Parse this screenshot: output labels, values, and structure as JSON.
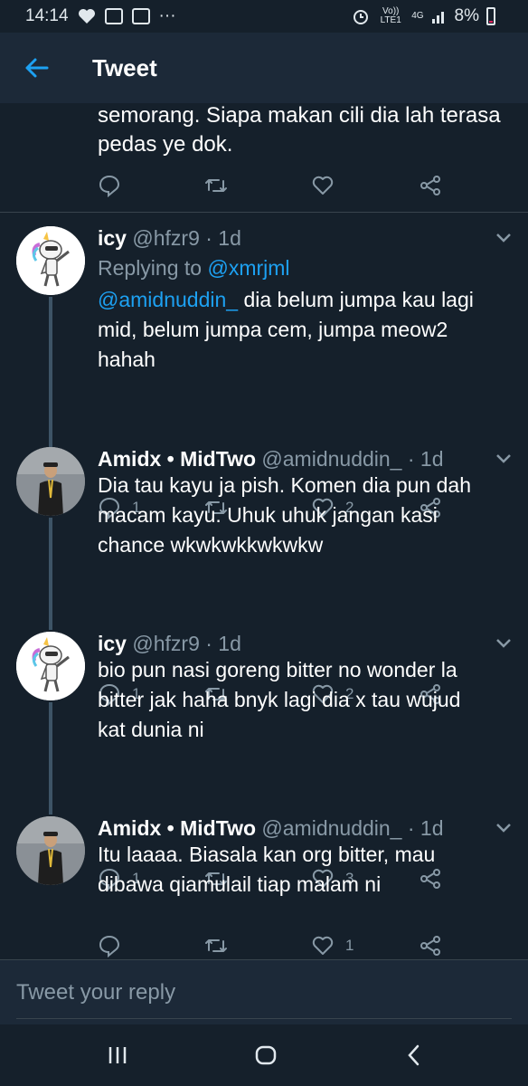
{
  "status_bar": {
    "time": "14:14",
    "signal_text": "Vo)) LTE1",
    "network": "4G",
    "battery": "8%"
  },
  "header": {
    "title": "Tweet"
  },
  "previous_tweet": {
    "text_line1": "semorang. Siapa makan cili dia lah terasa",
    "text_line2": "pedas ye dok."
  },
  "tweets": [
    {
      "name": "icy",
      "handle": "@hfzr9",
      "time": "· 1d",
      "replying_label": "Replying to",
      "replying_to": "@xmrjml",
      "mention": "@amidnuddin_",
      "text_line1": " dia belum jumpa kau lagi",
      "text_line2": "mid, belum jumpa cem, jumpa meow2",
      "text_line3": "hahah",
      "replies": "1",
      "likes": "2"
    },
    {
      "name": "Amidx • MidTwo",
      "handle": "@amidnuddin_",
      "time": "· 1d",
      "text_line1": "Dia tau kayu ja pish. Komen dia pun dah",
      "text_line2": "macam kayu. Uhuk uhuk jangan kasi",
      "text_line3": "chance wkwkwkkwkwkw",
      "replies": "1",
      "likes": "2"
    },
    {
      "name": "icy",
      "handle": "@hfzr9",
      "time": "· 1d",
      "text_line1": "bio pun nasi goreng bitter no wonder la",
      "text_line2": "bitter jak haha bnyk lagi dia x tau wujud",
      "text_line3": "kat dunia ni",
      "replies": "1",
      "likes": "3"
    },
    {
      "name": "Amidx • MidTwo",
      "handle": "@amidnuddin_",
      "time": "· 1d",
      "text_line1": "Itu laaaa. Biasala kan org bitter, mau",
      "text_line2": "dibawa qiamulail tiap malam ni",
      "likes": "1"
    }
  ],
  "reply_box": {
    "placeholder": "Tweet your reply"
  },
  "colors": {
    "background": "#15202b",
    "header": "#1c2938",
    "accent": "#1da1f2",
    "muted": "#8899a6"
  }
}
